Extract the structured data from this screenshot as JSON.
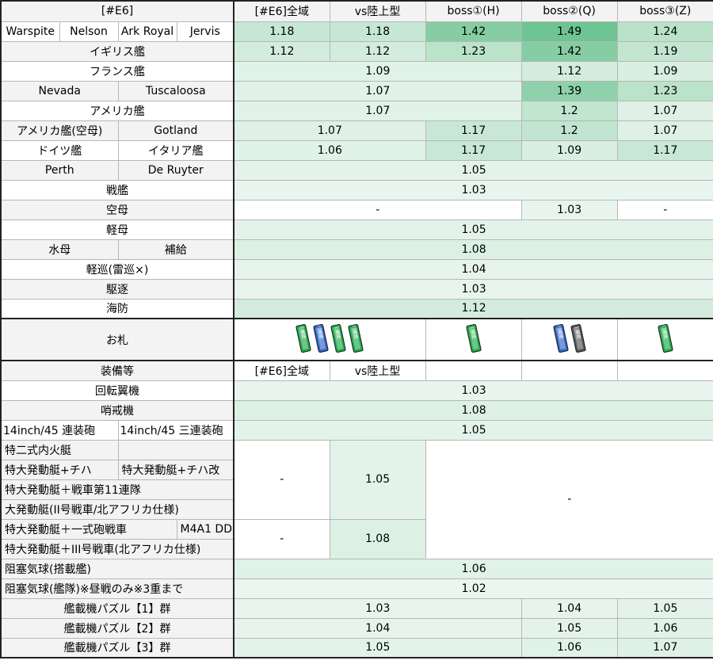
{
  "colors": {
    "c103": "#e8f5ee",
    "c105": "#e3f3ea",
    "c106": "#e1f2e8",
    "c107": "#dff1e6",
    "c108": "#dcf0e4",
    "c109": "#d9efe2",
    "c112": "#d3ecdd",
    "c117": "#c8e8d5",
    "c118": "#c6e7d3",
    "c119": "#c4e6d1",
    "c120": "#c1e5cf",
    "c123": "#bbe3ca",
    "c124": "#b9e2c9",
    "c139": "#8fd1ab",
    "c142": "#86cda4",
    "c149": "#6fc493",
    "header_bg": "#f3f3f3",
    "border": "#b7b7b7",
    "fuda_green": "#1fa84a",
    "fuda_blue": "#2f63c9",
    "fuda_gray": "#555555"
  },
  "header": {
    "corner": "[#E6]",
    "cols": [
      "[#E6]全域",
      "vs陸上型",
      "boss①(H)",
      "boss②(Q)",
      "boss③(Z)"
    ]
  },
  "ships": [
    {
      "names": [
        "Warspite",
        "Nelson",
        "Ark Royal",
        "Jervis"
      ],
      "values": [
        "1.18",
        "1.18",
        "1.42",
        "1.49",
        "1.24"
      ]
    },
    {
      "name": "イギリス艦",
      "values": [
        "1.12",
        "1.12",
        "1.23",
        "1.42",
        "1.19"
      ]
    },
    {
      "name": "フランス艦",
      "v_mid": "1.09",
      "v_q": "1.12",
      "v_z": "1.09"
    },
    {
      "names": [
        "Nevada",
        "Tuscaloosa"
      ],
      "v_mid": "1.07",
      "v_q": "1.39",
      "v_z": "1.23"
    },
    {
      "name": "アメリカ艦",
      "v_mid": "1.07",
      "v_q": "1.2",
      "v_z": "1.07"
    },
    {
      "names": [
        "アメリカ艦(空母)",
        "Gotland"
      ],
      "v_ab": "1.07",
      "v_h": "1.17",
      "v_q": "1.2",
      "v_z": "1.07"
    },
    {
      "names": [
        "ドイツ艦",
        "イタリア艦"
      ],
      "v_ab": "1.06",
      "v_h": "1.17",
      "v_q": "1.09",
      "v_z": "1.17"
    },
    {
      "names": [
        "Perth",
        "De Ruyter"
      ],
      "value": "1.05"
    },
    {
      "name": "戦艦",
      "value": "1.03"
    },
    {
      "name": "空母",
      "v_a3": "-",
      "v_q": "1.03",
      "v_z": "-"
    },
    {
      "name": "軽母",
      "value": "1.05"
    },
    {
      "names": [
        "水母",
        "補給"
      ],
      "value": "1.08"
    },
    {
      "name": "軽巡(雷巡×)",
      "value": "1.04"
    },
    {
      "name": "駆逐",
      "value": "1.03"
    },
    {
      "name": "海防",
      "value": "1.12"
    }
  ],
  "ofuda": {
    "label": "お札",
    "cols": [
      [
        {
          "text": "第一艦隊",
          "color": "green"
        },
        {
          "text": "第二艦隊",
          "color": "blue"
        },
        {
          "text": "第一艦隊",
          "color": "green"
        },
        {
          "text": "第二艦隊",
          "color": "green"
        }
      ],
      [
        {
          "text": "第一艦隊",
          "color": "green"
        }
      ],
      [
        {
          "text": "第二艦隊",
          "color": "blue"
        },
        {
          "text": "第一艦隊",
          "color": "gray"
        }
      ],
      [
        {
          "text": "第二艦隊",
          "color": "green"
        }
      ]
    ]
  },
  "equip_header": {
    "label": "装備等",
    "col1": "[#E6]全域",
    "col2": "vs陸上型"
  },
  "equipment": {
    "rotor": {
      "label": "回転翼機",
      "value": "1.03"
    },
    "patrol": {
      "label": "哨戒機",
      "value": "1.08"
    },
    "guns": {
      "labels": [
        "14inch/45 連装砲",
        "14inch/45 三連装砲"
      ],
      "value": "1.05"
    },
    "landing": {
      "rows": [
        [
          "特二式内火艇",
          ""
        ],
        [
          "特大発動艇+チハ",
          "特大発動艇+チハ改"
        ],
        [
          "特大発動艇＋戦車第11連隊",
          ""
        ],
        [
          "大発動艇(II号戦車/北アフリカ仕様)",
          ""
        ]
      ],
      "v_a": "-",
      "v_b": "1.05",
      "v_rest": "-"
    },
    "tank": {
      "rows": [
        [
          "特大発動艇＋一式砲戦車",
          "M4A1 DD"
        ],
        [
          "特大発動艇＋III号戦車(北アフリカ仕様)",
          ""
        ]
      ],
      "v_a": "-",
      "v_b": "1.08"
    },
    "balloon1": {
      "label": "阻塞気球(搭載艦)",
      "value": "1.06"
    },
    "balloon2": {
      "label": "阻塞気球(艦隊)※昼戦のみ※3重まで",
      "value": "1.02"
    },
    "puzzles": [
      {
        "label": "艦載機パズル【1】群",
        "v_mid": "1.03",
        "v_q": "1.04",
        "v_z": "1.05"
      },
      {
        "label": "艦載機パズル【2】群",
        "v_mid": "1.04",
        "v_q": "1.05",
        "v_z": "1.06"
      },
      {
        "label": "艦載機パズル【3】群",
        "v_mid": "1.05",
        "v_q": "1.06",
        "v_z": "1.07"
      }
    ]
  }
}
